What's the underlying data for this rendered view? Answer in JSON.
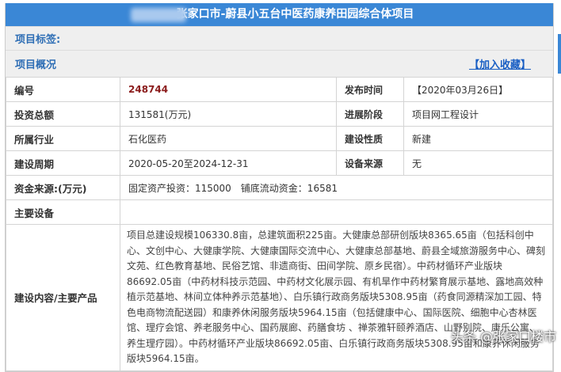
{
  "header": {
    "title": "张家口市-蔚县小五台中医药康养田园综合体项目"
  },
  "tags_label": "项目标签:",
  "overview_label": "项目概况",
  "favorite_link": "【加入收藏】",
  "rows": [
    {
      "l1": "编号",
      "v1": "248744",
      "l2": "发布时间",
      "v2": "【2020年03月26日】"
    },
    {
      "l1": "投资总额",
      "v1": "131581(万元)",
      "l2": "进展阶段",
      "v2": "项目网工程设计"
    },
    {
      "l1": "所属行业",
      "v1": "石化医药",
      "l2": "建设性质",
      "v2": "新建"
    },
    {
      "l1": "建设周期",
      "v1": "2020-05-20至2024-12-31",
      "l2": "设备来源",
      "v2": "无"
    }
  ],
  "funding": {
    "label": "资金来源:(万元)",
    "value": "固定资产投资：115000　铺底流动资金：16581"
  },
  "equipment": {
    "label": "主要设备",
    "value": ""
  },
  "content": {
    "label": "建设内容/主要产品",
    "value": "项目总建设规模106330.8亩，总建筑面积225亩。大健康总部研创版块8365.65亩（包括科创中心、文创中心、大健康学院、大健康国际交流中心、大健康总部基地、蔚县全域旅游服务中心、碑刻文苑、红色教育基地、民俗艺馆、非遗商街、田间学院、原乡民宿）。中药材循环产业版块86692.05亩（中药材科技示范园、中药材文化展示园、有机旱作中药材繁育展示基地、露地高效种植示范基地、林间立体种养示范基地）、白乐镇行政商务版块5308.95亩（药食同源精深加工园、特色电商物流配送园）和康养休闲服务版块5964.15亩（包括健康中心、国际医院、细胞中心杏林医馆、理疗会馆、养老服务中心、国药展廊、药膳食坊 、禅茶雅轩颐养酒店、山野别院、康乐公寓、养生理疗园）。中药材循环产业版块86692.05亩、白乐镇行政商务版块5308.95亩和康养休闲服务版块5964.15亩。"
  },
  "watermark": "头条 @张家口楼市"
}
